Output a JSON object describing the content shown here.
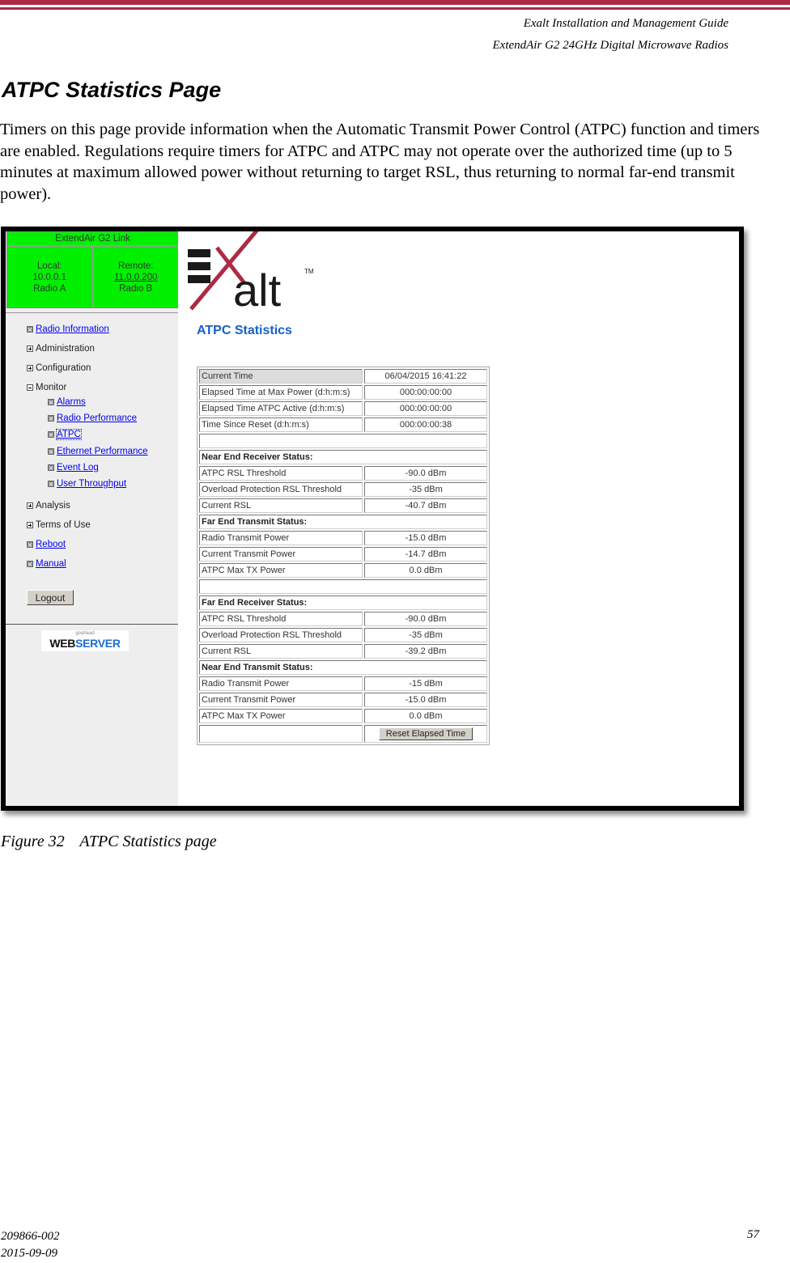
{
  "header": {
    "guide_title": "Exalt Installation and Management Guide",
    "product_title": "ExtendAir G2 24GHz Digital Microwave Radios",
    "accent_color": "#ad2a44"
  },
  "section": {
    "title": "ATPC Statistics Page",
    "intro": "Timers on this page provide information when the Automatic Transmit Power Control (ATPC) function and timers are enabled. Regulations require timers for ATPC and ATPC may not operate over the authorized time (up to 5 minutes at maximum allowed power without returning to target RSL, thus returning to normal far-end transmit power)."
  },
  "screenshot": {
    "link_box": {
      "title": "ExtendAir G2 Link",
      "local_label": "Local:",
      "local_ip": "10.0.0.1",
      "local_radio": "Radio A",
      "remote_label": "Remote:",
      "remote_ip": "11.0.0.200",
      "remote_radio": "Radio B",
      "color": "#00f000"
    },
    "nav": {
      "items": [
        {
          "label": "Radio Information",
          "icon": "page-icon",
          "link": true
        },
        {
          "label": "Administration",
          "icon": "expand-plus-icon",
          "link": false
        },
        {
          "label": "Configuration",
          "icon": "expand-plus-icon",
          "link": false
        },
        {
          "label": "Monitor",
          "icon": "collapse-minus-icon",
          "link": false
        },
        {
          "label": "Alarms",
          "icon": "page-icon",
          "link": true,
          "child": true
        },
        {
          "label": "Radio Performance",
          "icon": "page-icon",
          "link": true,
          "child": true
        },
        {
          "label": "ATPC",
          "icon": "page-icon",
          "link": true,
          "child": true,
          "active": true
        },
        {
          "label": "Ethernet Performance",
          "icon": "page-icon",
          "link": true,
          "child": true
        },
        {
          "label": "Event Log",
          "icon": "page-icon",
          "link": true,
          "child": true
        },
        {
          "label": "User Throughput",
          "icon": "page-icon",
          "link": true,
          "child": true
        },
        {
          "label": "Analysis",
          "icon": "expand-plus-icon",
          "link": false
        },
        {
          "label": "Terms of Use",
          "icon": "expand-plus-icon",
          "link": false
        },
        {
          "label": "Reboot",
          "icon": "page-icon",
          "link": true
        },
        {
          "label": "Manual",
          "icon": "page-icon",
          "link": true
        }
      ],
      "logout_label": "Logout"
    },
    "webserver_logo": {
      "small": "goahead",
      "web": "WEB",
      "server": "SERVER"
    },
    "brand": {
      "logo_text": "alt",
      "trademark": "TM"
    },
    "page_heading": "ATPC Statistics",
    "stats": {
      "timers": [
        {
          "label": "Current Time",
          "value": "06/04/2015 16:41:22"
        },
        {
          "label": "Elapsed Time at Max Power (d:h:m:s)",
          "value": "000:00:00:00"
        },
        {
          "label": "Elapsed Time ATPC Active (d:h:m:s)",
          "value": "000:00:00:00"
        },
        {
          "label": "Time Since Reset (d:h:m:s)",
          "value": "000:00:00:38"
        }
      ],
      "near_end_receiver": {
        "title": "Near End Receiver Status:",
        "rows": [
          {
            "label": "ATPC RSL Threshold",
            "value": "-90.0 dBm"
          },
          {
            "label": "Overload Protection RSL Threshold",
            "value": "-35 dBm"
          },
          {
            "label": "Current RSL",
            "value": "-40.7 dBm"
          }
        ]
      },
      "far_end_transmit": {
        "title": "Far End Transmit Status:",
        "rows": [
          {
            "label": "Radio Transmit Power",
            "value": "-15.0 dBm"
          },
          {
            "label": "Current Transmit Power",
            "value": "-14.7 dBm"
          },
          {
            "label": "ATPC Max TX Power",
            "value": "0.0 dBm"
          }
        ]
      },
      "far_end_receiver": {
        "title": "Far End Receiver Status:",
        "rows": [
          {
            "label": "ATPC RSL Threshold",
            "value": "-90.0 dBm"
          },
          {
            "label": "Overload Protection RSL Threshold",
            "value": "-35 dBm"
          },
          {
            "label": "Current RSL",
            "value": "-39.2 dBm"
          }
        ]
      },
      "near_end_transmit": {
        "title": "Near End Transmit Status:",
        "rows": [
          {
            "label": "Radio Transmit Power",
            "value": "-15 dBm"
          },
          {
            "label": "Current Transmit Power",
            "value": "-15.0 dBm"
          },
          {
            "label": "ATPC Max TX Power",
            "value": "0.0 dBm"
          }
        ]
      },
      "reset_button_label": "Reset Elapsed Time"
    }
  },
  "caption": {
    "number": "Figure 32",
    "text": "ATPC Statistics page"
  },
  "footer": {
    "doc_number": "209866-002",
    "date": "2015-09-09",
    "page_number": "57"
  }
}
